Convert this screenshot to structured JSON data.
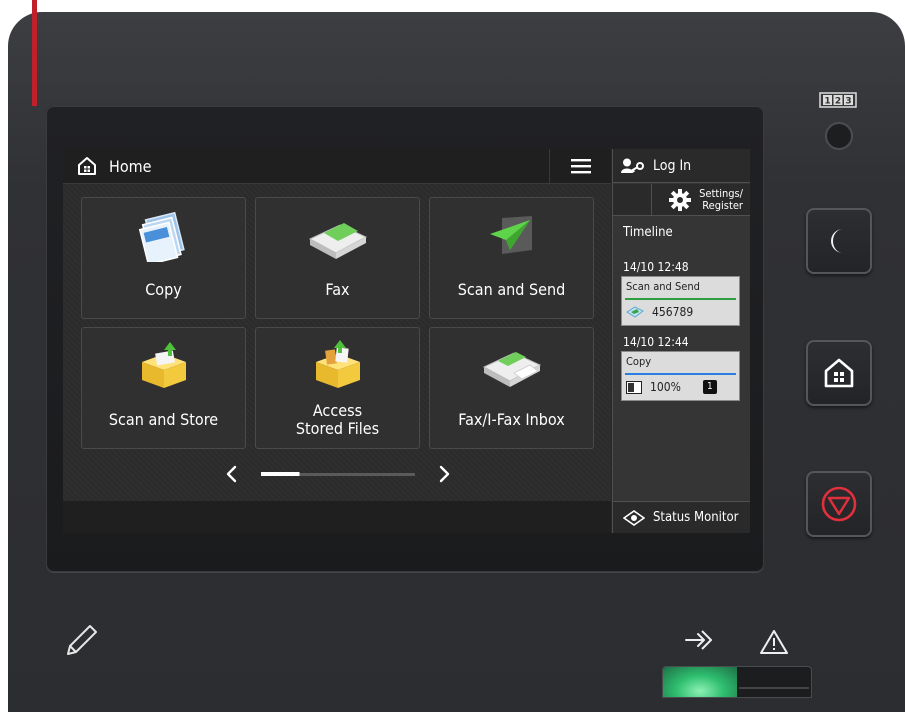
{
  "header": {
    "title": "Home",
    "menu_icon": "hamburger-menu-icon"
  },
  "tiles": [
    {
      "label": "Copy",
      "icon": "copy-icon"
    },
    {
      "label": "Fax",
      "icon": "fax-icon"
    },
    {
      "label": "Scan and Send",
      "icon": "scan-and-send-icon"
    },
    {
      "label": "Scan and Store",
      "icon": "scan-and-store-icon"
    },
    {
      "label": "Access\nStored Files",
      "icon": "access-stored-files-icon"
    },
    {
      "label": "Fax/I-Fax Inbox",
      "icon": "fax-inbox-icon"
    }
  ],
  "pager": {
    "current_page": 1,
    "total_pages": 4
  },
  "side": {
    "login": "Log In",
    "settings_line1": "Settings/",
    "settings_line2": "Register",
    "timeline_title": "Timeline",
    "jobs": [
      {
        "time": "14/10 12:48",
        "name": "Scan and Send",
        "detail": "456789",
        "color": "#2e9e3e"
      },
      {
        "time": "14/10 12:44",
        "name": "Copy",
        "detail": "100%",
        "copies": "1",
        "color": "#2a7de1"
      }
    ],
    "status_monitor": "Status Monitor"
  },
  "hardware": {
    "counter_label": "123",
    "buttons": [
      "sleep-icon",
      "home-icon",
      "stop-icon"
    ]
  },
  "colors": {
    "accent_red": "#c0202c",
    "stop_red": "#e0303c",
    "indicator_green": "#2fbf70"
  }
}
